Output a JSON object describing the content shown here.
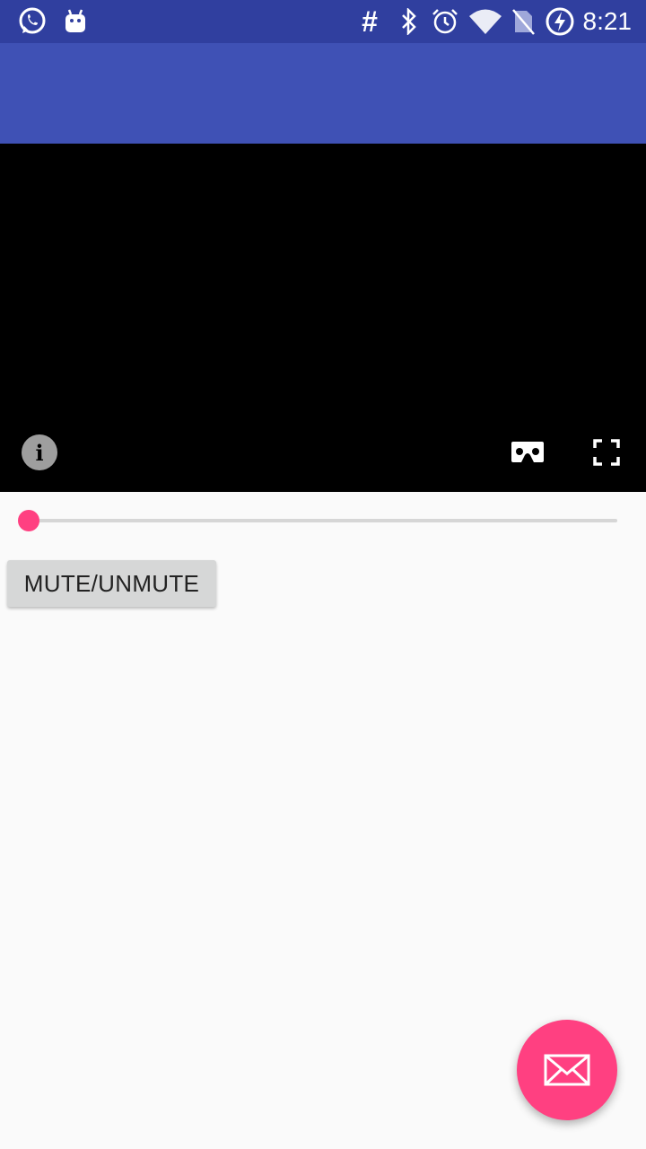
{
  "status_bar": {
    "time": "8:21",
    "left_icons": [
      "whatsapp-icon",
      "android-icon"
    ],
    "right_icons": [
      "hash-icon",
      "bluetooth-icon",
      "alarm-icon",
      "wifi-icon",
      "no-sim-icon",
      "battery-charging-icon"
    ]
  },
  "app_bar": {
    "color": "#3f51b5"
  },
  "video_player": {
    "controls": [
      "info-icon",
      "cardboard-vr-icon",
      "fullscreen-icon"
    ]
  },
  "seekbar": {
    "progress": 0,
    "accent": "#ff4081"
  },
  "mute_button": {
    "label": "MUTE/UNMUTE"
  },
  "fab": {
    "icon": "email-icon",
    "color": "#ff4081"
  }
}
